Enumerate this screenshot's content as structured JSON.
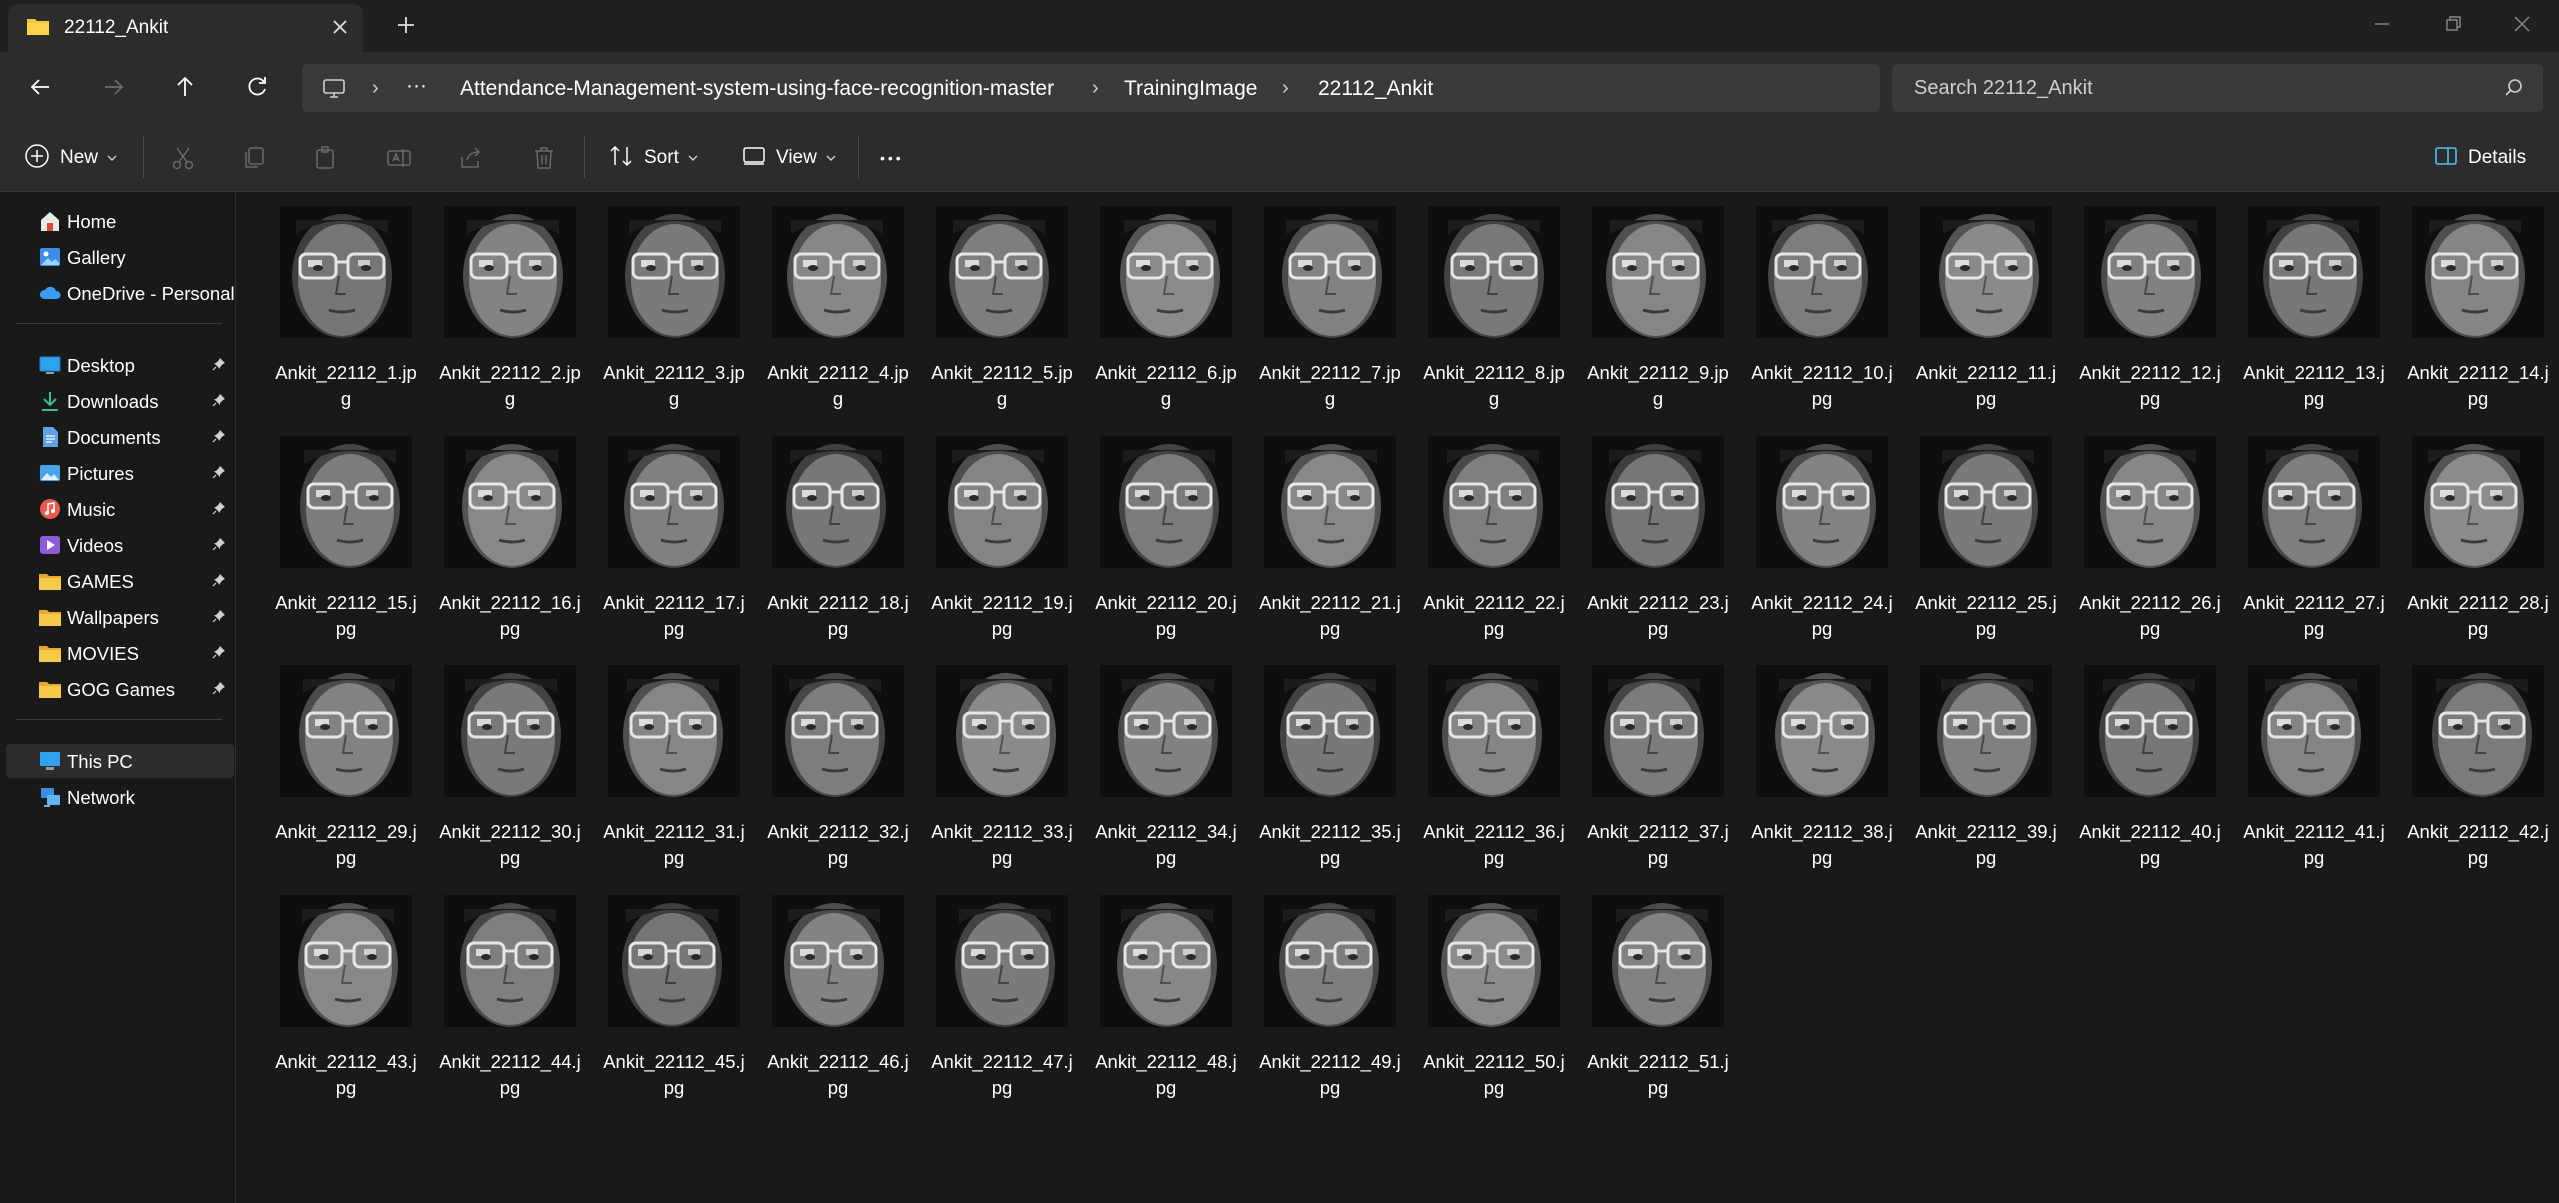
{
  "window": {
    "tab_title": "22112_Ankit"
  },
  "address": {
    "crumbs": [
      "Attendance-Management-system-using-face-recognition-master",
      "TrainingImage",
      "22112_Ankit"
    ],
    "more_label": "···"
  },
  "search": {
    "placeholder": "Search 22112_Ankit"
  },
  "commandbar": {
    "new_label": "New",
    "sort_label": "Sort",
    "view_label": "View",
    "more_label": "•••",
    "details_label": "Details"
  },
  "sidebar": {
    "top": [
      {
        "label": "Home",
        "icon": "home-icon"
      },
      {
        "label": "Gallery",
        "icon": "gallery-icon"
      },
      {
        "label": "OneDrive - Personal",
        "icon": "cloud-icon"
      }
    ],
    "pinned": [
      {
        "label": "Desktop",
        "icon": "desktop-icon"
      },
      {
        "label": "Downloads",
        "icon": "download-icon"
      },
      {
        "label": "Documents",
        "icon": "documents-icon"
      },
      {
        "label": "Pictures",
        "icon": "pictures-icon"
      },
      {
        "label": "Music",
        "icon": "music-icon"
      },
      {
        "label": "Videos",
        "icon": "videos-icon"
      },
      {
        "label": "GAMES",
        "icon": "folder-icon"
      },
      {
        "label": "Wallpapers",
        "icon": "folder-icon"
      },
      {
        "label": "MOVIES",
        "icon": "folder-icon"
      },
      {
        "label": "GOG Games",
        "icon": "folder-icon"
      }
    ],
    "bottom": [
      {
        "label": "This PC",
        "icon": "pc-icon",
        "selected": true
      },
      {
        "label": "Network",
        "icon": "network-icon"
      }
    ]
  },
  "files": [
    {
      "l1": "Ankit_22112_1.jp",
      "l2": "g"
    },
    {
      "l1": "Ankit_22112_2.jp",
      "l2": "g"
    },
    {
      "l1": "Ankit_22112_3.jp",
      "l2": "g"
    },
    {
      "l1": "Ankit_22112_4.jp",
      "l2": "g"
    },
    {
      "l1": "Ankit_22112_5.jp",
      "l2": "g"
    },
    {
      "l1": "Ankit_22112_6.jp",
      "l2": "g"
    },
    {
      "l1": "Ankit_22112_7.jp",
      "l2": "g"
    },
    {
      "l1": "Ankit_22112_8.jp",
      "l2": "g"
    },
    {
      "l1": "Ankit_22112_9.jp",
      "l2": "g"
    },
    {
      "l1": "Ankit_22112_10.j",
      "l2": "pg"
    },
    {
      "l1": "Ankit_22112_11.j",
      "l2": "pg"
    },
    {
      "l1": "Ankit_22112_12.j",
      "l2": "pg"
    },
    {
      "l1": "Ankit_22112_13.j",
      "l2": "pg"
    },
    {
      "l1": "Ankit_22112_14.j",
      "l2": "pg"
    },
    {
      "l1": "Ankit_22112_15.j",
      "l2": "pg"
    },
    {
      "l1": "Ankit_22112_16.j",
      "l2": "pg"
    },
    {
      "l1": "Ankit_22112_17.j",
      "l2": "pg"
    },
    {
      "l1": "Ankit_22112_18.j",
      "l2": "pg"
    },
    {
      "l1": "Ankit_22112_19.j",
      "l2": "pg"
    },
    {
      "l1": "Ankit_22112_20.j",
      "l2": "pg"
    },
    {
      "l1": "Ankit_22112_21.j",
      "l2": "pg"
    },
    {
      "l1": "Ankit_22112_22.j",
      "l2": "pg"
    },
    {
      "l1": "Ankit_22112_23.j",
      "l2": "pg"
    },
    {
      "l1": "Ankit_22112_24.j",
      "l2": "pg"
    },
    {
      "l1": "Ankit_22112_25.j",
      "l2": "pg"
    },
    {
      "l1": "Ankit_22112_26.j",
      "l2": "pg"
    },
    {
      "l1": "Ankit_22112_27.j",
      "l2": "pg"
    },
    {
      "l1": "Ankit_22112_28.j",
      "l2": "pg"
    },
    {
      "l1": "Ankit_22112_29.j",
      "l2": "pg"
    },
    {
      "l1": "Ankit_22112_30.j",
      "l2": "pg"
    },
    {
      "l1": "Ankit_22112_31.j",
      "l2": "pg"
    },
    {
      "l1": "Ankit_22112_32.j",
      "l2": "pg"
    },
    {
      "l1": "Ankit_22112_33.j",
      "l2": "pg"
    },
    {
      "l1": "Ankit_22112_34.j",
      "l2": "pg"
    },
    {
      "l1": "Ankit_22112_35.j",
      "l2": "pg"
    },
    {
      "l1": "Ankit_22112_36.j",
      "l2": "pg"
    },
    {
      "l1": "Ankit_22112_37.j",
      "l2": "pg"
    },
    {
      "l1": "Ankit_22112_38.j",
      "l2": "pg"
    },
    {
      "l1": "Ankit_22112_39.j",
      "l2": "pg"
    },
    {
      "l1": "Ankit_22112_40.j",
      "l2": "pg"
    },
    {
      "l1": "Ankit_22112_41.j",
      "l2": "pg"
    },
    {
      "l1": "Ankit_22112_42.j",
      "l2": "pg"
    },
    {
      "l1": "Ankit_22112_43.j",
      "l2": "pg"
    },
    {
      "l1": "Ankit_22112_44.j",
      "l2": "pg"
    },
    {
      "l1": "Ankit_22112_45.j",
      "l2": "pg"
    },
    {
      "l1": "Ankit_22112_46.j",
      "l2": "pg"
    },
    {
      "l1": "Ankit_22112_47.j",
      "l2": "pg"
    },
    {
      "l1": "Ankit_22112_48.j",
      "l2": "pg"
    },
    {
      "l1": "Ankit_22112_49.j",
      "l2": "pg"
    },
    {
      "l1": "Ankit_22112_50.j",
      "l2": "pg"
    },
    {
      "l1": "Ankit_22112_51.j",
      "l2": "pg"
    }
  ],
  "colors": {
    "background": "#191919",
    "toolbar": "#2c2c2c",
    "folder": "#f5c242",
    "accent": "#4cc2ff"
  }
}
